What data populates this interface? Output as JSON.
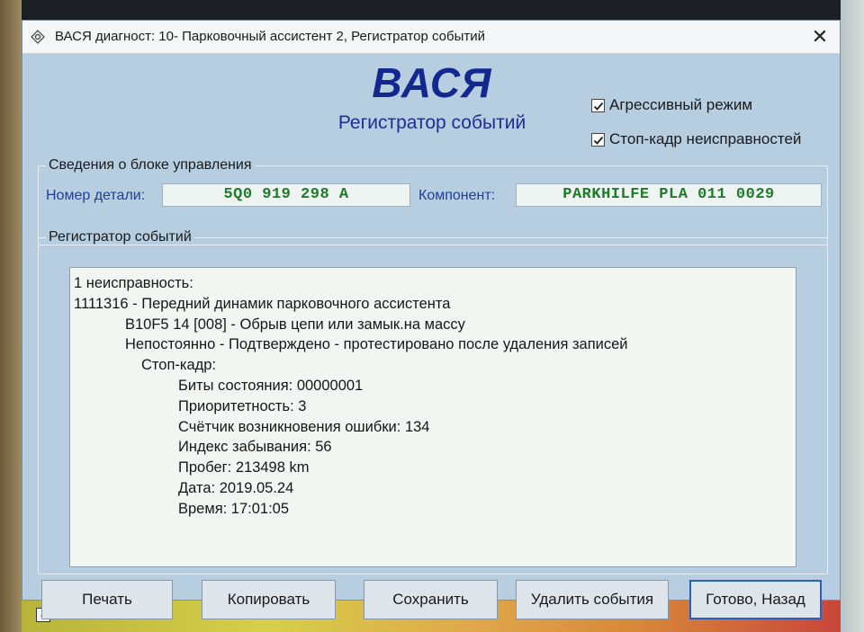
{
  "window": {
    "title": "ВАСЯ диагност: 10- Парковочный ассистент 2,  Регистратор событий",
    "close_glyph": "✕"
  },
  "header": {
    "brand": "ВАСЯ",
    "subtitle": "Регистратор событий"
  },
  "options": {
    "aggressive_mode": {
      "label": "Агрессивный режим",
      "checked": true
    },
    "freeze_frame": {
      "label": "Стоп-кадр неисправностей",
      "checked": true
    }
  },
  "control_unit": {
    "legend": "Сведения о блоке управления",
    "part_number_label": "Номер детали:",
    "part_number": "5Q0 919 298 A",
    "component_label": "Компонент:",
    "component": "PARKHILFE PLA 011 0029"
  },
  "event_log": {
    "legend": "Регистратор событий",
    "lines": [
      {
        "text": "1 неисправность:",
        "indent": 0
      },
      {
        "text": "1111316 - Передний динамик парковочного ассистента",
        "indent": 0
      },
      {
        "text": "B10F5 14 [008] - Обрыв цепи или замык.на массу",
        "indent": 1
      },
      {
        "text": "Непостоянно - Подтверждено - протестировано после удаления записей",
        "indent": 1
      },
      {
        "text": "Стоп-кадр:",
        "indent": 2
      },
      {
        "text": "Биты состояния: 00000001",
        "indent": 3
      },
      {
        "text": "Приоритетность: 3",
        "indent": 3
      },
      {
        "text": "Счётчик возникновения ошибки: 134",
        "indent": 3
      },
      {
        "text": "Индекс забывания: 56",
        "indent": 3
      },
      {
        "text": "Пробег: 213498 km",
        "indent": 3
      },
      {
        "text": "Дата: 2019.05.24",
        "indent": 3
      },
      {
        "text": "Время: 17:01:05",
        "indent": 3
      }
    ]
  },
  "buttons": {
    "print": "Печать",
    "copy": "Копировать",
    "save": "Сохранить",
    "delete_events": "Удалить события",
    "done_back": "Готово, Назад"
  },
  "icons": {
    "app": "vasya-app-icon",
    "close": "close-icon",
    "checkmark": "checkmark-icon",
    "desktop_shortcut": "shortcut-arrow-icon"
  },
  "colors": {
    "window_bg": "#b7cde0",
    "brand": "#12288f",
    "label": "#1d3f9a",
    "value": "#1f7a2a"
  }
}
